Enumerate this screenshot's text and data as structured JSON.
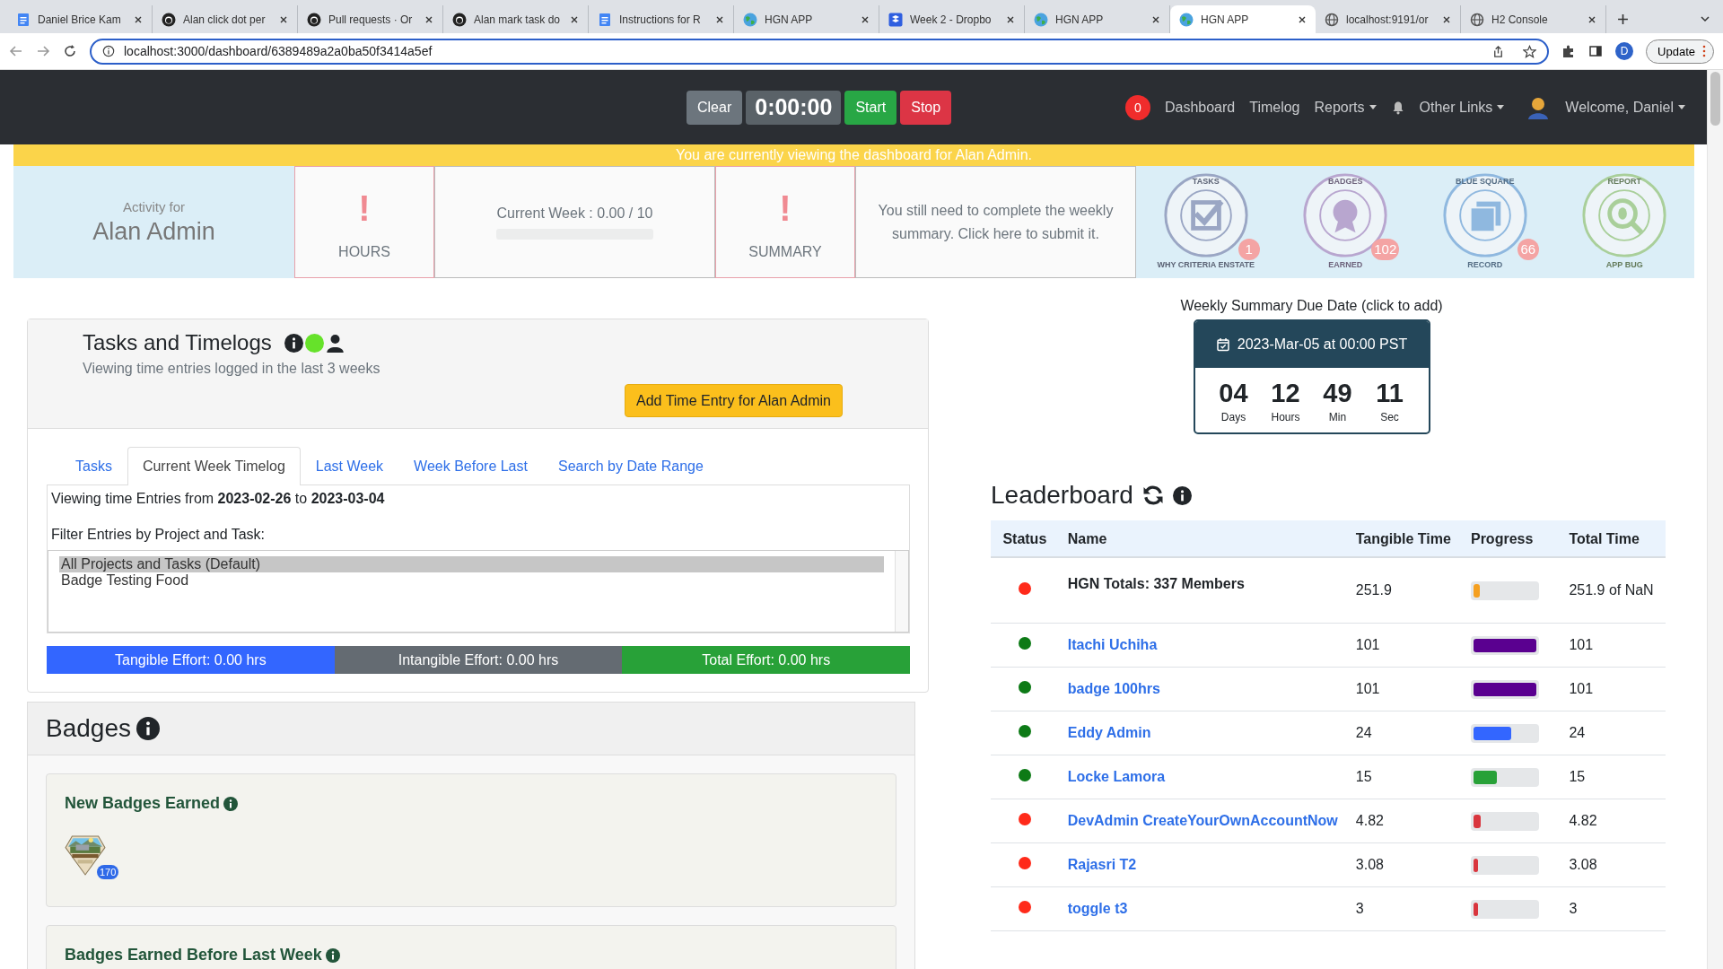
{
  "browser": {
    "tabs": [
      {
        "kind": "doc",
        "title": "Daniel Brice Kam",
        "selected": false
      },
      {
        "kind": "github",
        "title": "Alan click dot per",
        "selected": false
      },
      {
        "kind": "github",
        "title": "Pull requests · Or",
        "selected": false
      },
      {
        "kind": "github",
        "title": "Alan mark task do",
        "selected": false
      },
      {
        "kind": "doc",
        "title": "Instructions for R",
        "selected": false
      },
      {
        "kind": "hgn",
        "title": "HGN APP",
        "selected": false
      },
      {
        "kind": "dropbox",
        "title": "Week 2 - Dropbo",
        "selected": false
      },
      {
        "kind": "hgn",
        "title": "HGN APP",
        "selected": false
      },
      {
        "kind": "hgn",
        "title": "HGN APP",
        "selected": true
      },
      {
        "kind": "globe",
        "title": "localhost:9191/or",
        "selected": false
      },
      {
        "kind": "globe",
        "title": "H2 Console",
        "selected": false
      }
    ],
    "url": "localhost:3000/dashboard/6389489a2a0ba50f3414a5ef",
    "profile": "D",
    "update": "Update"
  },
  "navbar": {
    "timer": {
      "clear": "Clear",
      "time": "0:00:00",
      "start": "Start",
      "stop": "Stop"
    },
    "notification_count": "0",
    "links": [
      {
        "label": "Dashboard",
        "dropdown": false
      },
      {
        "label": "Timelog",
        "dropdown": false
      },
      {
        "label": "Reports",
        "dropdown": true
      }
    ],
    "other_links": {
      "label": "Other Links",
      "dropdown": true
    },
    "welcome": {
      "label": "Welcome, Daniel",
      "dropdown": true
    }
  },
  "banner": "You are currently viewing the dashboard for Alan Admin.",
  "activity": {
    "label": "Activity for",
    "name": "Alan Admin",
    "hours": {
      "mark": "!",
      "label": "HOURS"
    },
    "current_week": {
      "text": "Current Week : 0.00 / 10",
      "level": 0
    },
    "summary": {
      "mark": "!",
      "label": "SUMMARY"
    },
    "summary_note": "You still need to complete the weekly summary. Click here to submit it.",
    "badges": [
      {
        "kind": "tasks",
        "top": "TASKS",
        "bottom": "WHY CRITERIA ENSTATE",
        "count": "1",
        "color": "#9aa6c4"
      },
      {
        "kind": "badges",
        "top": "BADGES",
        "bottom": "EARNED",
        "count": "102",
        "color": "#b8a6cf"
      },
      {
        "kind": "square",
        "top": "BLUE SQUARE",
        "bottom": "RECORD",
        "count": "66",
        "color": "#8fb8df"
      },
      {
        "kind": "bug",
        "top": "REPORT",
        "bottom": "APP BUG",
        "color": "#a9cf9a"
      }
    ]
  },
  "tasks_panel": {
    "title": "Tasks and Timelogs",
    "subtitle": "Viewing time entries logged in the last 3 weeks",
    "add_button": "Add Time Entry for Alan Admin",
    "tabs": [
      {
        "label": "Tasks",
        "selected": false
      },
      {
        "label": "Current Week Timelog",
        "selected": true
      },
      {
        "label": "Last Week",
        "selected": false
      },
      {
        "label": "Week Before Last",
        "selected": false
      },
      {
        "label": "Search by Date Range",
        "selected": false
      }
    ],
    "range_text": "Viewing time Entries from **2023-02-26** to **2023-03-04**",
    "filter_label": "Filter Entries by Project and Task:",
    "filter_options": [
      {
        "label": "All Projects and Tasks (Default)",
        "selected": true
      },
      {
        "label": "Badge Testing Food",
        "selected": false
      }
    ],
    "efforts": [
      {
        "label": "Tangible Effort: 0.00 hrs",
        "color": "#3366ff"
      },
      {
        "label": "Intangible Effort: 0.00 hrs",
        "color": "#646b72"
      },
      {
        "label": "Total Effort: 0.00 hrs",
        "color": "#28a138"
      }
    ]
  },
  "badges_panel": {
    "title": "Badges",
    "new_title": "New Badges Earned",
    "new_badges": [
      {
        "kind": "picture",
        "count": "170"
      }
    ],
    "before_title": "Badges Earned Before Last Week"
  },
  "due_date": {
    "caption": "Weekly Summary Due Date (click to add)",
    "date": "2023-Mar-05 at 00:00 PST",
    "units": [
      {
        "value": "04",
        "label": "Days"
      },
      {
        "value": "12",
        "label": "Hours"
      },
      {
        "value": "49",
        "label": "Min"
      },
      {
        "value": "11",
        "label": "Sec"
      }
    ]
  },
  "leaderboard": {
    "title": "Leaderboard",
    "columns": [
      "Status",
      "Name",
      "Tangible Time",
      "Progress",
      "Total Time"
    ],
    "rows": [
      {
        "kind": "total",
        "color": "#ff2a1a",
        "name": "HGN Totals: 337 Members",
        "tangible": "251.9",
        "progress": {
          "level": 0.1,
          "color": "#f5a020"
        },
        "total": "251.9 of NaN"
      },
      {
        "kind": "member",
        "color": "#0d7a16",
        "name": "Itachi Uchiha",
        "tangible": "101",
        "progress": {
          "level": 1,
          "color": "#5a0090"
        },
        "total": "101"
      },
      {
        "kind": "member",
        "color": "#0d7a16",
        "name": "badge 100hrs",
        "tangible": "101",
        "progress": {
          "level": 1,
          "color": "#5a0090"
        },
        "total": "101"
      },
      {
        "kind": "member",
        "color": "#0d7a16",
        "name": "Eddy Admin",
        "tangible": "24",
        "progress": {
          "level": 0.6,
          "color": "#3366ff"
        },
        "total": "24"
      },
      {
        "kind": "member",
        "color": "#0d7a16",
        "name": "Locke Lamora",
        "tangible": "15",
        "progress": {
          "level": 0.37,
          "color": "#28a138"
        },
        "total": "15"
      },
      {
        "kind": "member",
        "color": "#ff2a1a",
        "name": "DevAdmin CreateYourOwnAccountNow",
        "tangible": "4.82",
        "progress": {
          "level": 0.11,
          "color": "#d9363e"
        },
        "total": "4.82"
      },
      {
        "kind": "member",
        "color": "#ff2a1a",
        "name": "Rajasri T2",
        "tangible": "3.08",
        "progress": {
          "level": 0.07,
          "color": "#d9363e"
        },
        "total": "3.08"
      },
      {
        "kind": "member",
        "color": "#ff2a1a",
        "name": "toggle t3",
        "tangible": "3",
        "progress": {
          "level": 0.07,
          "color": "#d9363e"
        },
        "total": "3"
      }
    ]
  }
}
